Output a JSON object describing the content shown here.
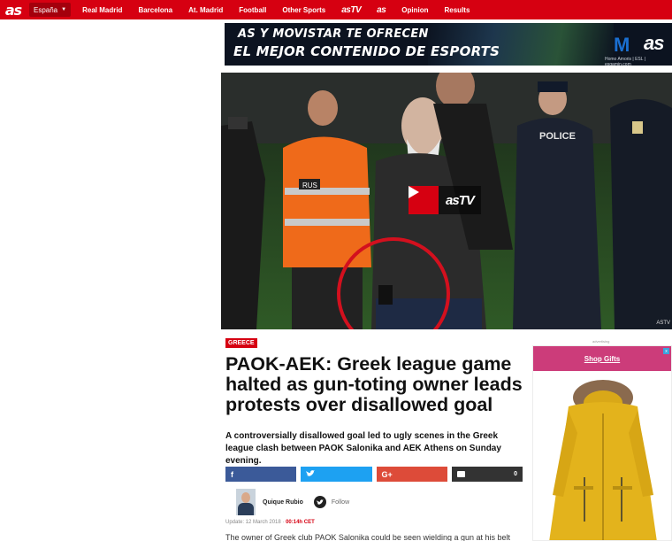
{
  "nav": {
    "logo": "as",
    "edition": "España",
    "items": [
      "Real Madrid",
      "Barcelona",
      "At. Madrid",
      "Football",
      "Other Sports",
      "asTV",
      "as",
      "Opinion",
      "Results"
    ]
  },
  "banner": {
    "line1": "AS Y MOVISTAR TE OFRECEN",
    "line2": "EL MEJOR CONTENIDO DE ESPORTS",
    "brand_as": "as",
    "footer": "Homo Amoris | ESL | esgamin.com"
  },
  "hero": {
    "player_logo": "asTV",
    "credit": "ASTV",
    "vest_text": "RUS",
    "police_text": "POLICE"
  },
  "article": {
    "tag": "GREECE",
    "headline": "PAOK-AEK: Greek league game halted as gun-toting owner leads protests over disallowed goal",
    "subheadline": "A controversially disallowed goal led to ugly scenes in the Greek league clash between PAOK Salonika and AEK Athens on Sunday evening.",
    "share": {
      "facebook": "f",
      "twitter": "t",
      "google": "G+",
      "comments": "0"
    },
    "author": "Quique Rubio",
    "follow": "Follow",
    "update_prefix": "Update: 12 March 2018",
    "update_sep": " · ",
    "update_time": "00:14h CET",
    "body_start": "The owner of Greek club PAOK Salonika could be seen wielding a gun at his belt"
  },
  "ad": {
    "label": "advertising",
    "cta": "Shop Gifts",
    "close": "x"
  },
  "colors": {
    "brand_red": "#d60011",
    "facebook": "#3b5a99",
    "twitter": "#1da1f2",
    "google": "#dd4b39",
    "comments": "#333333",
    "ad_header": "#cc3c7a"
  }
}
